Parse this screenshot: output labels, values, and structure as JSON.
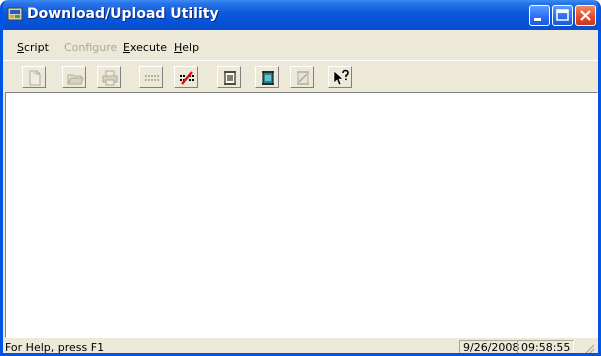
{
  "window": {
    "title": "Download/Upload Utility"
  },
  "menu": [
    {
      "label": "Script",
      "underline": "S",
      "rest": "cript",
      "enabled": true
    },
    {
      "label": "Configure",
      "underline": "",
      "rest": "Configure",
      "enabled": false
    },
    {
      "label": "Execute",
      "underline": "E",
      "rest": "xecute",
      "enabled": true
    },
    {
      "label": "Help",
      "underline": "H",
      "rest": "elp",
      "enabled": true
    }
  ],
  "toolbar": {
    "buttons": [
      {
        "name": "new-script",
        "icon": "new-document-icon",
        "enabled": false
      },
      {
        "name": "open-script",
        "icon": "open-folder-icon",
        "enabled": false
      },
      {
        "name": "print",
        "icon": "printer-icon",
        "enabled": false
      },
      {
        "name": "connect",
        "icon": "connect-icon",
        "enabled": false
      },
      {
        "name": "disconnect",
        "icon": "disconnect-icon",
        "enabled": true
      },
      {
        "name": "download",
        "icon": "scroll-download-icon",
        "enabled": true
      },
      {
        "name": "upload",
        "icon": "scroll-upload-icon",
        "enabled": true
      },
      {
        "name": "compare",
        "icon": "compare-icon",
        "enabled": false
      },
      {
        "name": "context-help",
        "icon": "help-pointer-icon",
        "enabled": true
      }
    ]
  },
  "status": {
    "message": "For Help, press F1",
    "date": "9/26/2008",
    "time": "09:58:55"
  }
}
